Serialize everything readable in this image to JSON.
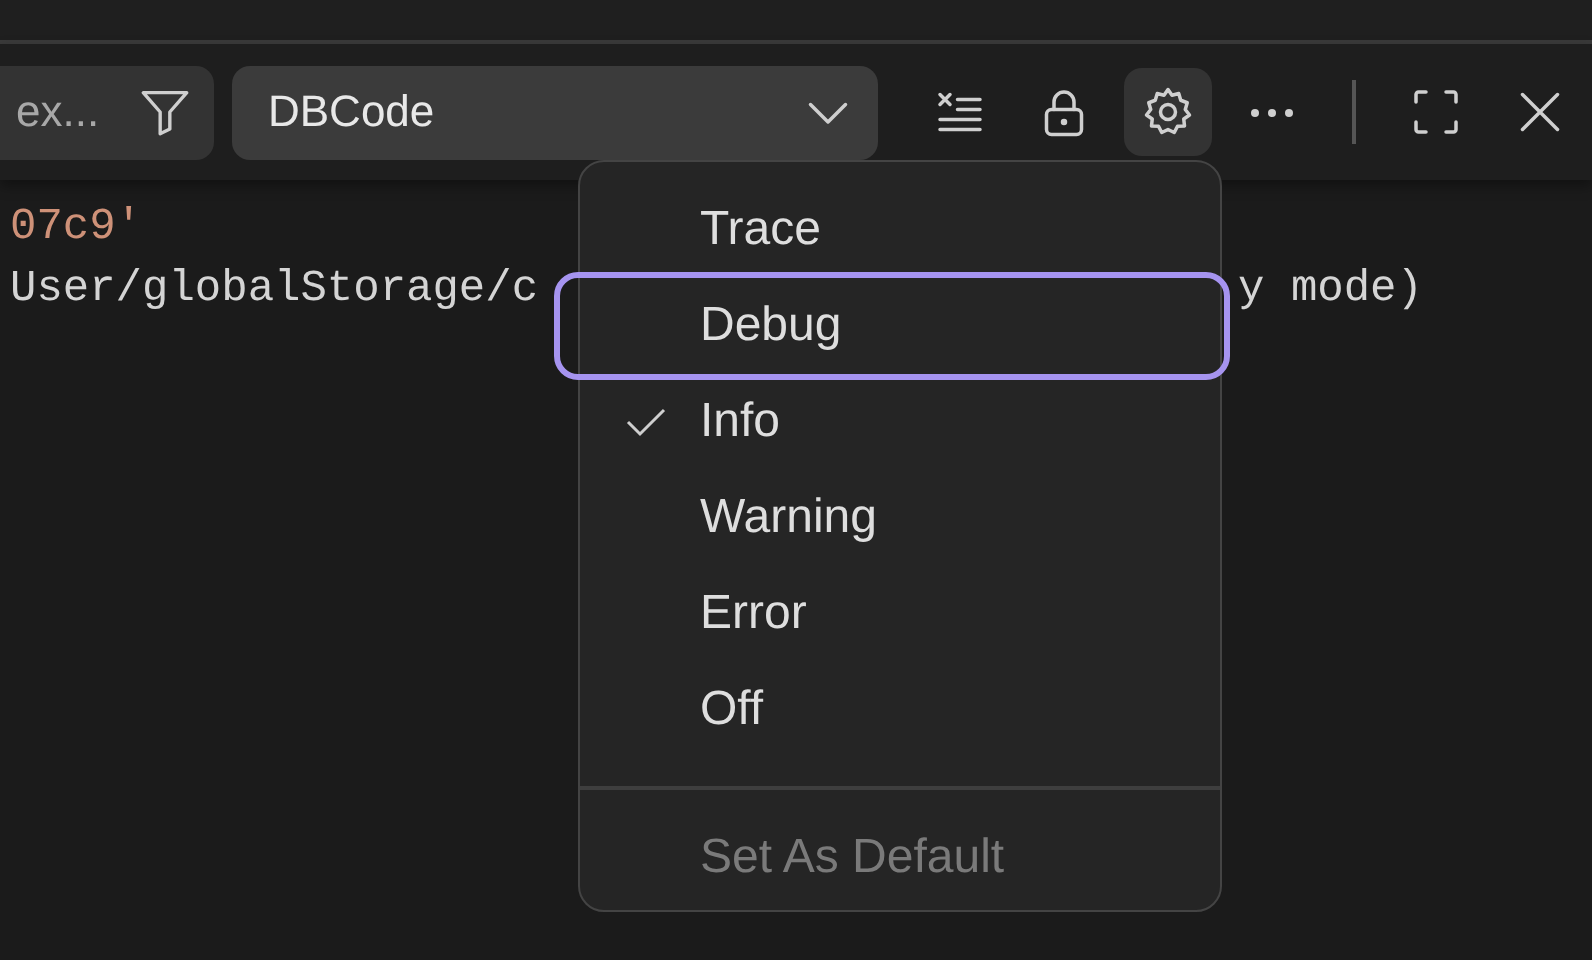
{
  "toolbar": {
    "filter": {
      "placeholder": "ex..."
    },
    "channel_select": {
      "value": "DBCode"
    },
    "actions": [
      {
        "kind": "clear"
      },
      {
        "kind": "lock"
      },
      {
        "kind": "settings",
        "selected": true
      },
      {
        "kind": "more",
        "selected": false
      },
      {
        "kind": "divider"
      },
      {
        "kind": "maximize"
      },
      {
        "kind": "close"
      }
    ]
  },
  "log_lines": [
    {
      "kind": "string",
      "parts": [
        "07c9'"
      ]
    },
    {
      "kind": "plain",
      "parts": [
        "User/globalStorage/c",
        "y mode)"
      ]
    }
  ],
  "level_menu": {
    "items": [
      {
        "label": "Trace",
        "checked": false,
        "focused": false
      },
      {
        "label": "Debug",
        "checked": false,
        "focused": true
      },
      {
        "label": "Info",
        "checked": true,
        "focused": false
      },
      {
        "label": "Warning",
        "checked": false,
        "focused": false
      },
      {
        "label": "Error",
        "checked": false,
        "focused": false
      },
      {
        "label": "Off",
        "checked": false,
        "focused": false
      }
    ],
    "footer": {
      "label": "Set As Default",
      "disabled": true
    }
  }
}
